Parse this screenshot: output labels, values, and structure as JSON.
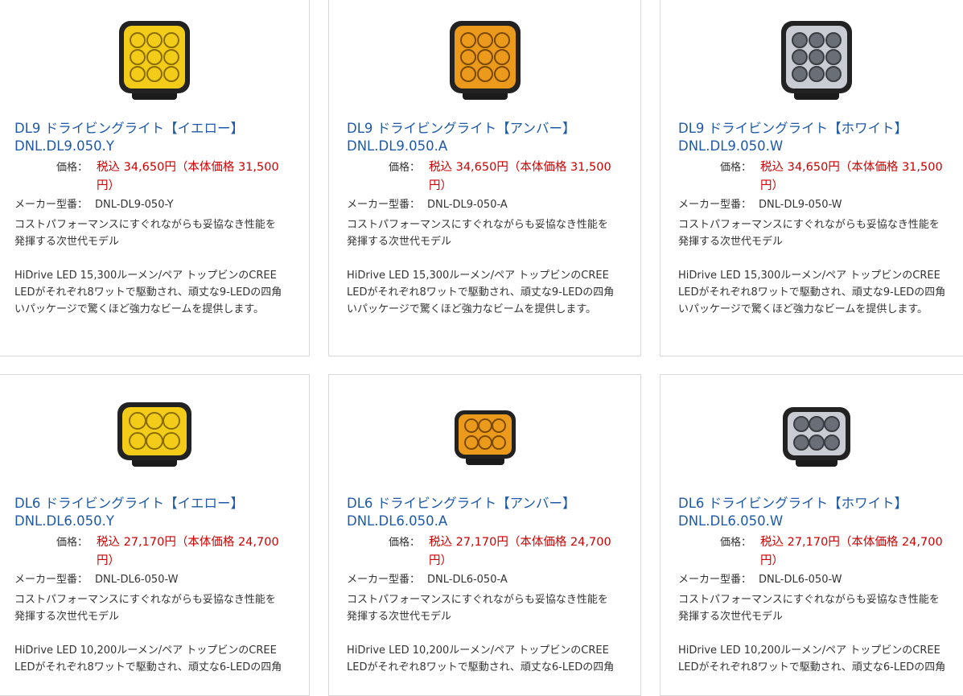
{
  "price_label": "価格：",
  "model_label": "メーカー型番：",
  "desc_line1": "コストパフォーマンスにすぐれながらも妥協なき性能を",
  "desc_line2": "発揮する次世代モデル",
  "products": [
    {
      "name": "DL9 ドライビングライト【イエロー】",
      "code": "DNL.DL9.050.Y",
      "price": "税込 34,650円（本体価格 31,500",
      "price_end": "円）",
      "model": "DNL-DL9-050-Y",
      "spec1": "HiDrive LED 15,300ルーメン/ペア トップビンのCREE",
      "spec2": "LEDがそれぞれ8ワットで駆動され、頑丈な9-LEDの四角",
      "spec3": "いパッケージで驚くほど強力なビームを提供します。",
      "lens_color": "#f2cc18"
    },
    {
      "name": "DL9 ドライビングライト【アンバー】",
      "code": "DNL.DL9.050.A",
      "price": "税込 34,650円（本体価格 31,500",
      "price_end": "円）",
      "model": "DNL-DL9-050-A",
      "spec1": "HiDrive LED 15,300ルーメン/ペア トップビンのCREE",
      "spec2": "LEDがそれぞれ8ワットで駆動され、頑丈な9-LEDの四角",
      "spec3": "いパッケージで驚くほど強力なビームを提供します。",
      "lens_color": "#eb9a1c"
    },
    {
      "name": "DL9 ドライビングライト【ホワイト】",
      "code": "DNL.DL9.050.W",
      "price": "税込 34,650円（本体価格 31,500",
      "price_end": "円）",
      "model": "DNL-DL9-050-W",
      "spec1": "HiDrive LED 15,300ルーメン/ペア トップビンのCREE",
      "spec2": "LEDがそれぞれ8ワットで駆動され、頑丈な9-LEDの四角",
      "spec3": "いパッケージで驚くほど強力なビームを提供します。",
      "lens_color": "#c9ccd2"
    },
    {
      "name": "DL6 ドライビングライト【イエロー】",
      "code": "DNL.DL6.050.Y",
      "price": "税込 27,170円（本体価格 24,700",
      "price_end": "円）",
      "model": "DNL-DL6-050-W",
      "spec1": "HiDrive LED 10,200ルーメン/ペア トップビンのCREE",
      "spec2": "LEDがそれぞれ8ワットで駆動され、頑丈な6-LEDの四角",
      "spec3": "",
      "lens_color": "#f2cc18"
    },
    {
      "name": "DL6 ドライビングライト【アンバー】",
      "code": "DNL.DL6.050.A",
      "price": "税込 27,170円（本体価格 24,700",
      "price_end": "円）",
      "model": "DNL-DL6-050-A",
      "spec1": "HiDrive LED 10,200ルーメン/ペア トップビンのCREE",
      "spec2": "LEDがそれぞれ8ワットで駆動され、頑丈な6-LEDの四角",
      "spec3": "",
      "lens_color": "#eb9a1c"
    },
    {
      "name": "DL6 ドライビングライト【ホワイト】",
      "code": "DNL.DL6.050.W",
      "price": "税込 27,170円（本体価格 24,700",
      "price_end": "円）",
      "model": "DNL-DL6-050-W",
      "spec1": "HiDrive LED 10,200ルーメン/ペア トップビンのCREE",
      "spec2": "LEDがそれぞれ8ワットで駆動され、頑丈な6-LEDの四角",
      "spec3": "",
      "lens_color": "#c9ccd2"
    }
  ]
}
